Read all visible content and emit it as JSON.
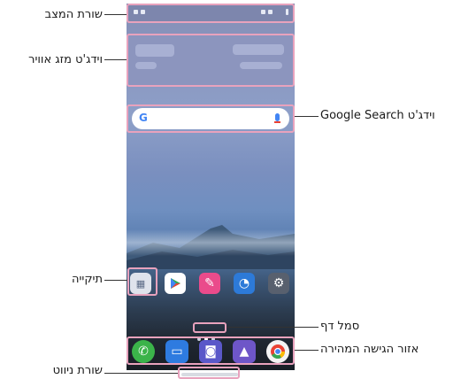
{
  "callouts": {
    "status_bar": "שורת המצב",
    "weather_widget": "וידג'ט מזג אוויר",
    "google_search_widget": "וידג'ט Google Search",
    "folder": "תיקייה",
    "page_icon": "סמל דף",
    "quick_access": "אזור הגישה המהירה",
    "nav_bar": "שורת ניווט"
  },
  "home_screen": {
    "search": {
      "logo": "G"
    },
    "apps": [
      "folder-icon",
      "play-store-icon",
      "pen-icon",
      "clock-icon",
      "settings-icon"
    ],
    "dock": [
      "phone-icon",
      "messages-icon",
      "camera-icon",
      "gallery-icon",
      "chrome-icon"
    ],
    "pages": 3,
    "current_page": 2
  },
  "colors": {
    "highlight": "#e8a2bd",
    "google_blue": "#4285f4"
  }
}
